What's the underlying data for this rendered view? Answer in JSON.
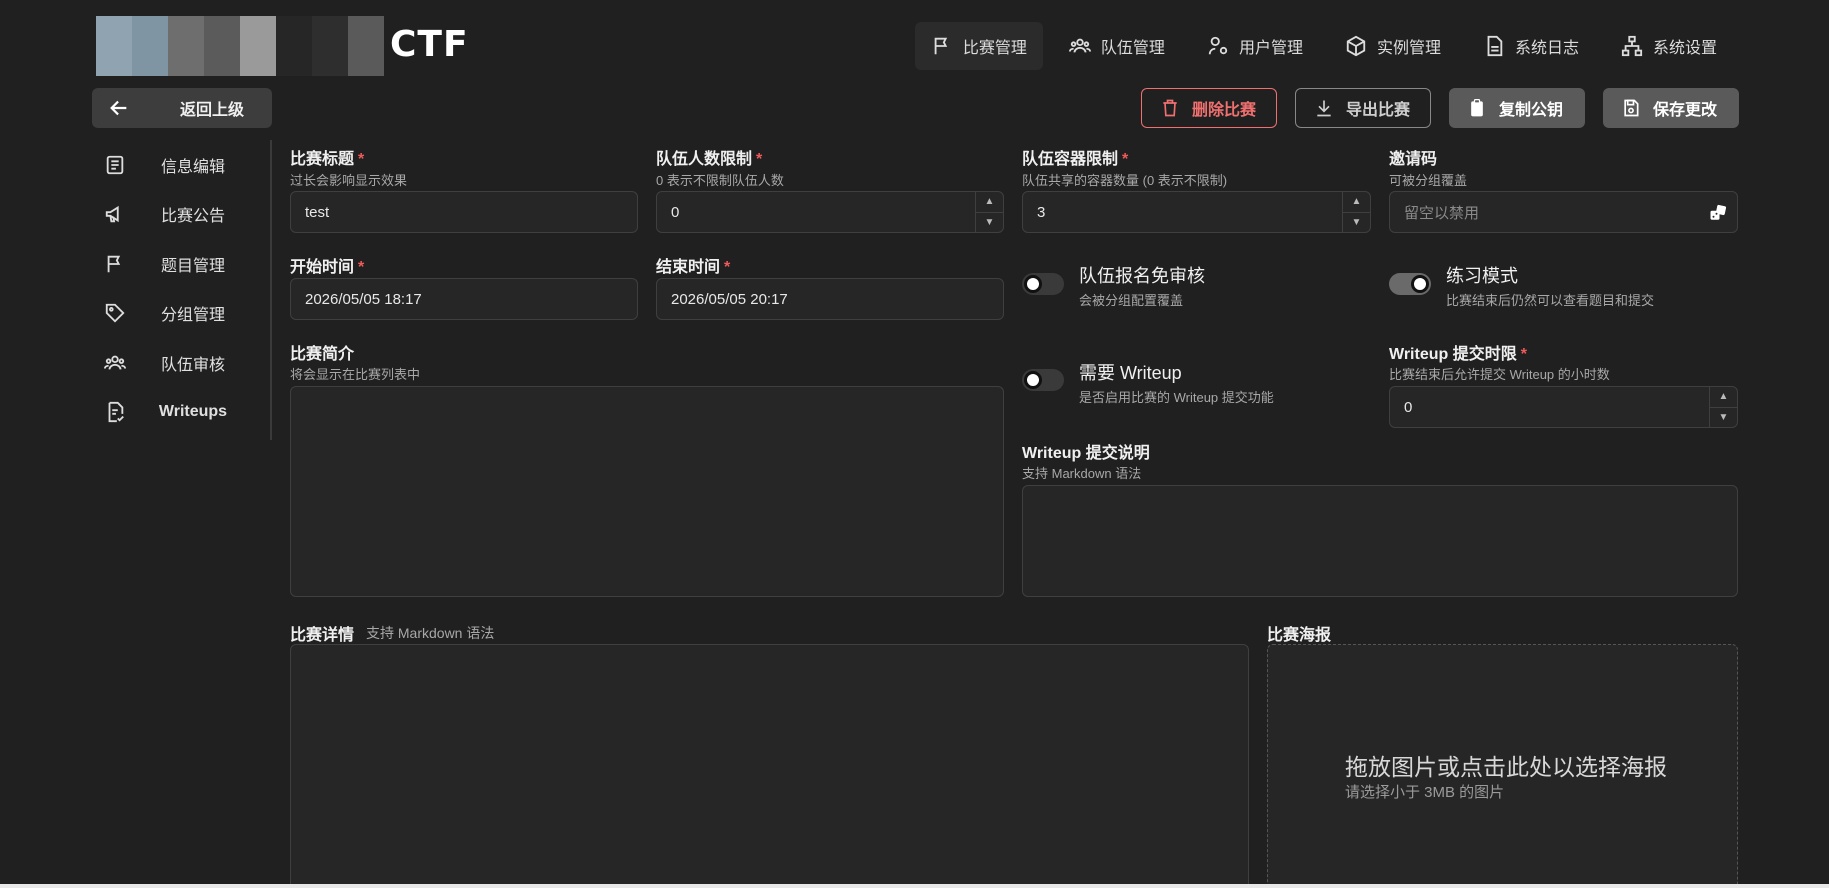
{
  "header": {
    "logo_text": "CTF",
    "nav": [
      {
        "label": "比赛管理",
        "icon": "flag-icon",
        "active": true
      },
      {
        "label": "队伍管理",
        "icon": "users-icon",
        "active": false
      },
      {
        "label": "用户管理",
        "icon": "user-cog-icon",
        "active": false
      },
      {
        "label": "实例管理",
        "icon": "box-icon",
        "active": false
      },
      {
        "label": "系统日志",
        "icon": "file-text-icon",
        "active": false
      },
      {
        "label": "系统设置",
        "icon": "sitemap-icon",
        "active": false
      }
    ]
  },
  "actions": {
    "back": "返回上级",
    "delete": "删除比赛",
    "export": "导出比赛",
    "copy_key": "复制公钥",
    "save": "保存更改"
  },
  "sidenav": [
    {
      "label": "信息编辑",
      "icon": "document-list-icon"
    },
    {
      "label": "比赛公告",
      "icon": "megaphone-icon"
    },
    {
      "label": "题目管理",
      "icon": "flag-icon"
    },
    {
      "label": "分组管理",
      "icon": "tag-icon"
    },
    {
      "label": "队伍审核",
      "icon": "users-icon"
    },
    {
      "label": "Writeups",
      "icon": "file-check-icon"
    }
  ],
  "form": {
    "title": {
      "label": "比赛标题",
      "desc": "过长会影响显示效果",
      "value": "test"
    },
    "team_limit": {
      "label": "队伍人数限制",
      "desc": "0 表示不限制队伍人数",
      "value": "0"
    },
    "container_limit": {
      "label": "队伍容器限制",
      "desc": "队伍共享的容器数量 (0 表示不限制)",
      "value": "3"
    },
    "invite_code": {
      "label": "邀请码",
      "desc": "可被分组覆盖",
      "placeholder": "留空以禁用"
    },
    "start_time": {
      "label": "开始时间",
      "value": "2026/05/05 18:17"
    },
    "end_time": {
      "label": "结束时间",
      "value": "2026/05/05 20:17"
    },
    "auto_accept": {
      "title": "队伍报名免审核",
      "desc": "会被分组配置覆盖",
      "enabled": false
    },
    "practice_mode": {
      "title": "练习模式",
      "desc": "比赛结束后仍然可以查看题目和提交",
      "enabled": true
    },
    "summary": {
      "label": "比赛简介",
      "desc": "将会显示在比赛列表中"
    },
    "writeup_required": {
      "title": "需要 Writeup",
      "desc": "是否启用比赛的 Writeup 提交功能",
      "enabled": false
    },
    "writeup_deadline": {
      "label": "Writeup 提交时限",
      "desc": "比赛结束后允许提交 Writeup 的小时数",
      "value": "0"
    },
    "writeup_note": {
      "label": "Writeup 提交说明",
      "desc": "支持 Markdown 语法"
    },
    "details": {
      "label": "比赛详情",
      "desc": "支持 Markdown 语法"
    },
    "poster": {
      "label": "比赛海报",
      "drop_title": "拖放图片或点击此处以选择海报",
      "drop_desc": "请选择小于 3MB 的图片"
    }
  },
  "colors": {
    "background": "#202020",
    "danger": "#f07070",
    "required": "#f05a5a"
  }
}
